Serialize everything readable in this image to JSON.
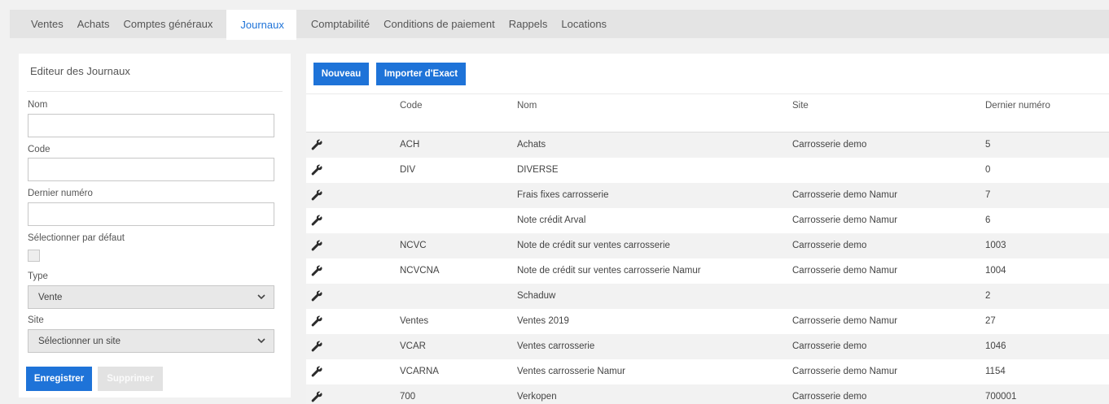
{
  "tabs": [
    "Ventes",
    "Achats",
    "Comptes généraux",
    "Journaux",
    "Comptabilité",
    "Conditions de paiement",
    "Rappels",
    "Locations"
  ],
  "active_tab": "Journaux",
  "editor": {
    "title": "Editeur des Journaux",
    "fields": {
      "nom_label": "Nom",
      "nom_value": "",
      "code_label": "Code",
      "code_value": "",
      "dernier_label": "Dernier numéro",
      "dernier_value": "",
      "default_label": "Sélectionner par défaut",
      "default_checked": false,
      "type_label": "Type",
      "type_value": "Vente",
      "site_label": "Site",
      "site_value": "Sélectionner un site"
    },
    "save_label": "Enregistrer",
    "delete_label": "Supprimer"
  },
  "toolbar": {
    "new_label": "Nouveau",
    "import_label": "Importer d'Exact"
  },
  "table": {
    "headers": [
      "Code",
      "Nom",
      "Site",
      "Dernier numéro"
    ],
    "rows": [
      {
        "code": "ACH",
        "nom": "Achats",
        "site": "Carrosserie demo",
        "dernier": "5"
      },
      {
        "code": "DIV",
        "nom": "DIVERSE",
        "site": "",
        "dernier": "0"
      },
      {
        "code": "",
        "nom": "Frais fixes carrosserie",
        "site": "Carrosserie demo Namur",
        "dernier": "7"
      },
      {
        "code": "",
        "nom": "Note crédit Arval",
        "site": "Carrosserie demo Namur",
        "dernier": "6"
      },
      {
        "code": "NCVC",
        "nom": "Note de crédit sur ventes carrosserie",
        "site": "Carrosserie demo",
        "dernier": "1003"
      },
      {
        "code": "NCVCNA",
        "nom": "Note de crédit sur ventes carrosserie Namur",
        "site": "Carrosserie demo Namur",
        "dernier": "1004"
      },
      {
        "code": "",
        "nom": "Schaduw",
        "site": "",
        "dernier": "2"
      },
      {
        "code": "Ventes",
        "nom": "Ventes 2019",
        "site": "Carrosserie demo Namur",
        "dernier": "27"
      },
      {
        "code": "VCAR",
        "nom": "Ventes carrosserie",
        "site": "Carrosserie demo",
        "dernier": "1046"
      },
      {
        "code": "VCARNA",
        "nom": "Ventes carrosserie Namur",
        "site": "Carrosserie demo Namur",
        "dernier": "1154"
      },
      {
        "code": "700",
        "nom": "Verkopen",
        "site": "Carrosserie demo",
        "dernier": "700001"
      }
    ]
  },
  "colors": {
    "accent": "#1e73d8",
    "tab_bar": "#e4e4e4",
    "row_alt": "#f2f2f2",
    "page_bg": "#f1f1f1"
  },
  "icons": {
    "row_action": "wrench-icon",
    "select": "chevron-down-icon"
  }
}
